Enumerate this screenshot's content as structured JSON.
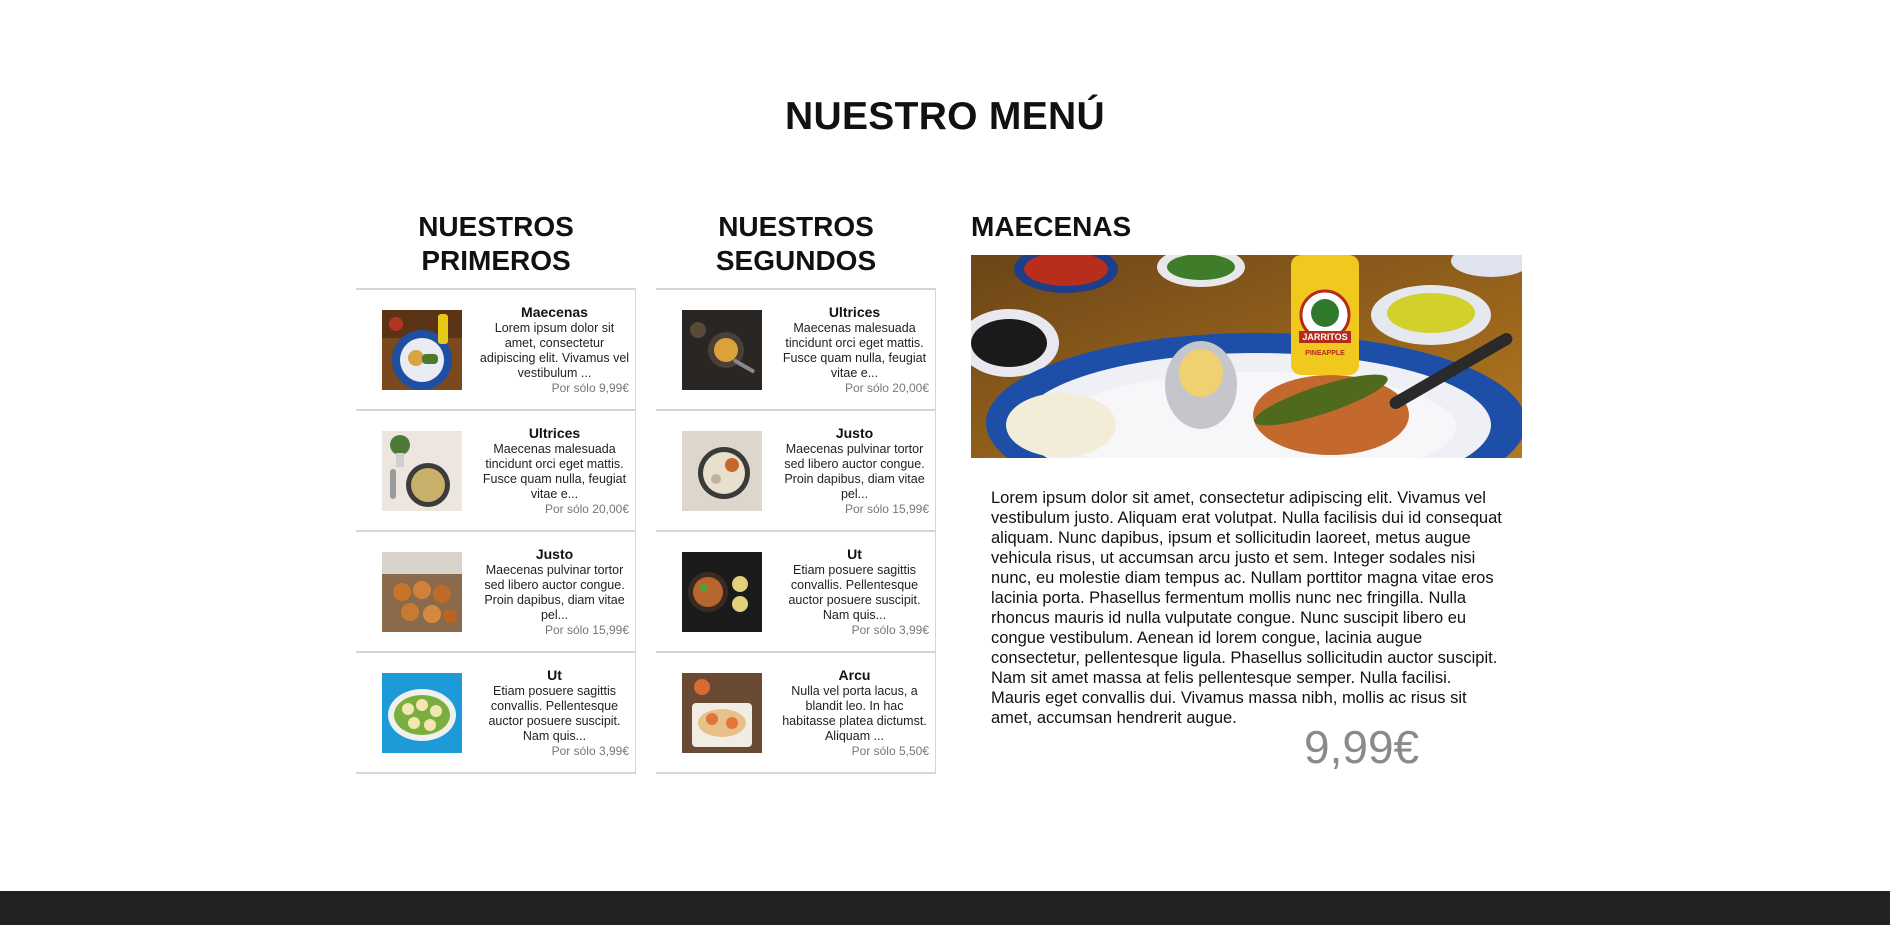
{
  "page": {
    "title": "NUESTRO MENÚ"
  },
  "colors": {
    "footer": "#222222",
    "divider": "#d6d6d6",
    "price_gray": "#8a8a8a"
  },
  "first_courses": {
    "title": "NUESTROS PRIMEROS",
    "items": [
      {
        "name": "Maecenas",
        "description": "Lorem ipsum dolor sit amet, consectetur adipiscing elit. Vivamus vel vestibulum ...",
        "price": "Por sólo 9,99€",
        "icon": "plate-image"
      },
      {
        "name": "Ultrices",
        "description": "Maecenas malesuada tincidunt orci eget mattis. Fusce quam nulla, feugiat vitae e...",
        "price": "Por sólo 20,00€",
        "icon": "soup-image"
      },
      {
        "name": "Justo",
        "description": "Maecenas pulvinar tortor sed libero auctor congue. Proin dapibus, diam vitae pel...",
        "price": "Por sólo 15,99€",
        "icon": "fried-food-image"
      },
      {
        "name": "Ut",
        "description": "Etiam posuere sagittis convallis. Pellentesque auctor posuere suscipit. Nam quis...",
        "price": "Por sólo 3,99€",
        "icon": "salad-image"
      }
    ]
  },
  "second_courses": {
    "title": "NUESTROS SEGUNDOS",
    "items": [
      {
        "name": "Ultrices",
        "description": "Maecenas malesuada tincidunt orci eget mattis. Fusce quam nulla, feugiat vitae e...",
        "price": "Por sólo 20,00€",
        "icon": "dark-dish-image"
      },
      {
        "name": "Justo",
        "description": "Maecenas pulvinar tortor sed libero auctor congue. Proin dapibus, diam vitae pel...",
        "price": "Por sólo 15,99€",
        "icon": "rice-bowl-image"
      },
      {
        "name": "Ut",
        "description": "Etiam posuere sagittis convallis. Pellentesque auctor posuere suscipit. Nam quis...",
        "price": "Por sólo 3,99€",
        "icon": "bowls-image"
      },
      {
        "name": "Arcu",
        "description": "Nulla vel porta lacus, a blandit leo. In hac habitasse platea dictumst. Aliquam ...",
        "price": "Por sólo 5,50€",
        "icon": "shrimp-dish-image"
      }
    ]
  },
  "featured": {
    "title": "MAECENAS",
    "description": "Lorem ipsum dolor sit amet, consectetur adipiscing elit. Vivamus vel vestibulum justo. Aliquam erat volutpat. Nulla facilisis dui id consequat aliquam. Nunc dapibus, ipsum et sollicitudin laoreet, metus augue vehicula risus, ut accumsan arcu justo et sem. Integer sodales nisi nunc, eu molestie diam tempus ac. Nullam porttitor magna vitae eros lacinia porta. Phasellus fermentum mollis nunc nec fringilla. Nulla rhoncus mauris id nulla vulputate congue. Nunc suscipit libero eu congue vestibulum. Aenean id lorem congue, lacinia augue consectetur, pellentesque ligula. Phasellus sollicitudin auctor suscipit. Nam sit amet massa at felis pellentesque semper. Nulla facilisi. Mauris eget convallis dui. Vivamus massa nibh, mollis ac risus sit amet, accumsan hendrerit augue.",
    "price": "9,99€",
    "image_label": "JARRITOS",
    "image_sublabel": "PINEAPPLE"
  }
}
